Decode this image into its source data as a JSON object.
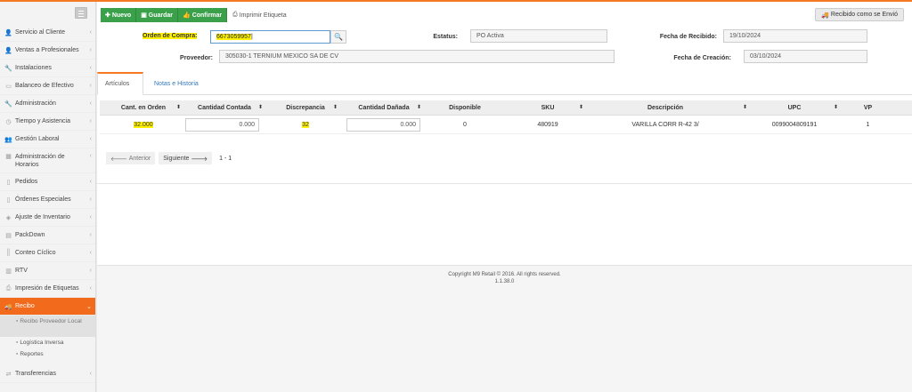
{
  "sidebar": {
    "items": [
      {
        "icon": "user-icon",
        "glyph": "👤",
        "label": "Servicio al Cliente"
      },
      {
        "icon": "user-icon",
        "glyph": "👤",
        "label": "Ventas a Profesionales"
      },
      {
        "icon": "wrench-icon",
        "glyph": "🔧",
        "label": "Instalaciones"
      },
      {
        "icon": "money-icon",
        "glyph": "▭",
        "label": "Balanceo de Efectivo"
      },
      {
        "icon": "wrench-icon",
        "glyph": "🔧",
        "label": "Administración"
      },
      {
        "icon": "clock-icon",
        "glyph": "◷",
        "label": "Tiempo y Asistencia"
      },
      {
        "icon": "users-icon",
        "glyph": "👥",
        "label": "Gestión Laboral"
      },
      {
        "icon": "calendar-icon",
        "glyph": "▦",
        "label": "Administración de Horarios"
      },
      {
        "icon": "document-icon",
        "glyph": "▯",
        "label": "Pedidos"
      },
      {
        "icon": "document-icon",
        "glyph": "▯",
        "label": "Órdenes Especiales"
      },
      {
        "icon": "box-icon",
        "glyph": "◈",
        "label": "Ajuste de Inventario"
      },
      {
        "icon": "archive-icon",
        "glyph": "▤",
        "label": "PackDown"
      },
      {
        "icon": "barcode-icon",
        "glyph": "║",
        "label": "Conteo Cíclico"
      },
      {
        "icon": "barcode-icon",
        "glyph": "▥",
        "label": "RTV"
      },
      {
        "icon": "print-icon",
        "glyph": "⎙",
        "label": "Impresión de Etiquetas"
      },
      {
        "icon": "truck-icon",
        "glyph": "🚚",
        "label": "Recibo"
      },
      {
        "icon": "exchange-icon",
        "glyph": "⇄",
        "label": "Transferencias"
      }
    ],
    "subitems": [
      {
        "label": "Recibo Proveedor Local"
      },
      {
        "label": "Logística Inversa"
      },
      {
        "label": "Reportes"
      }
    ]
  },
  "toolbar": {
    "nuevo": "Nuevo",
    "guardar": "Guardar",
    "confirmar": "Confirmar",
    "imprimir": "Imprimir Etiqueta",
    "recibido": "Recibido como se Envió"
  },
  "form": {
    "orden_label": "Orden de Compra:",
    "orden_value": "6673059957",
    "estatus_label": "Estatus:",
    "estatus_value": "PO Activa",
    "fecha_recibido_label": "Fecha de Recibido:",
    "fecha_recibido_value": "19/10/2024",
    "proveedor_label": "Proveedor:",
    "proveedor_value": "305030-1 TERNIUM MEXICO SA DE CV",
    "fecha_creacion_label": "Fecha de Creación:",
    "fecha_creacion_value": "03/10/2024"
  },
  "tabs": {
    "articulos": "Artículos",
    "notas": "Notas e Historia"
  },
  "grid": {
    "headers": {
      "cant_orden": "Cant. en Orden",
      "cant_contada": "Cantidad Contada",
      "discrepancia": "Discrepancia",
      "cant_danada": "Cantidad Dañada",
      "disponible": "Disponible",
      "sku": "SKU",
      "descripcion": "Descripción",
      "upc": "UPC",
      "vp": "VP"
    },
    "row": {
      "cant_orden": "32.000",
      "cant_contada": "0.000",
      "discrepancia": "32",
      "cant_danada": "0.000",
      "disponible": "0",
      "sku": "480919",
      "descripcion": "VARILLA CORR R-42 3/",
      "upc": "0099004809191",
      "vp": "1"
    }
  },
  "pager": {
    "anterior": "Anterior",
    "siguiente": "Siguiente",
    "info": "1 - 1"
  },
  "footer": {
    "copyright": "Copyright M9 Retail © 2016. All rights reserved.",
    "version": "1.1.38.0"
  },
  "colors": {
    "accent": "#f47920",
    "active_menu": "#f26a1b",
    "button_green": "#3aa14a",
    "highlight": "#fff200",
    "link": "#3379b7"
  }
}
